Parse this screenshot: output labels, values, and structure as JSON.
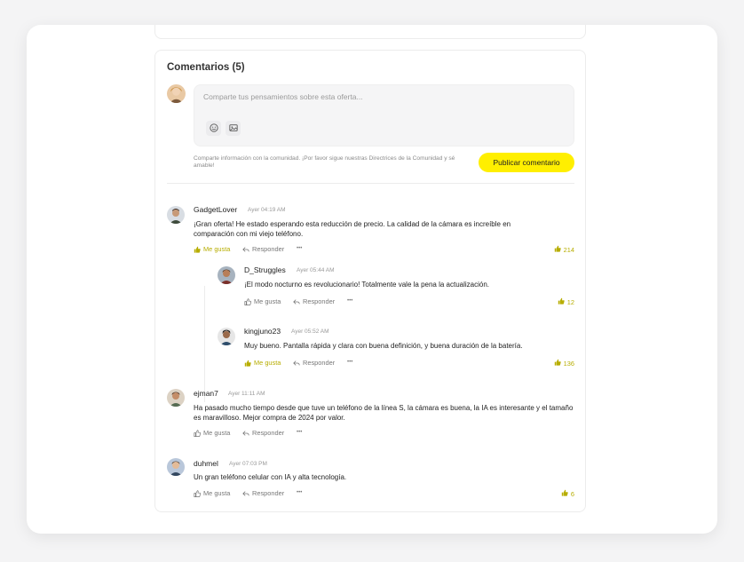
{
  "comments_title": "Comentarios (5)",
  "composer": {
    "placeholder": "Comparte tus pensamientos sobre esta oferta...",
    "hint": "Comparte información con la comunidad. ¡Por favor sigue nuestras Directrices de la Comunidad y sé amable!",
    "publish_label": "Publicar comentario"
  },
  "labels": {
    "like": "Me gusta",
    "reply": "Responder",
    "more": "•••"
  },
  "comments": [
    {
      "author": "GadgetLover",
      "time": "Ayer 04:19 AM",
      "text": "¡Gran oferta! He estado esperando esta reducción de precio. La calidad de la cámara es increíble en comparación con mi viejo teléfono.",
      "likes": "214",
      "liked": true
    },
    {
      "author": "D_Struggles",
      "time": "Ayer 05:44 AM",
      "text": "¡El modo nocturno es revolucionario! Totalmente vale la pena la actualización.",
      "likes": "12",
      "liked": false
    },
    {
      "author": "kingjuno23",
      "time": "Ayer 05:52 AM",
      "text": "Muy bueno. Pantalla rápida y clara con buena definición, y buena duración de la batería.",
      "likes": "136",
      "liked": true
    },
    {
      "author": "ejman7",
      "time": "Ayer 11:11 AM",
      "text": "Ha pasado mucho tiempo desde que tuve un teléfono de la línea S, la cámara es buena, la IA es interesante y el tamaño es maravilloso. Mejor compra de 2024 por valor.",
      "likes": "",
      "liked": false
    },
    {
      "author": "duhmel",
      "time": "Ayer 07:03 PM",
      "text": "Un gran teléfono celular con IA y alta tecnología.",
      "likes": "6",
      "liked": false
    }
  ],
  "colors": {
    "accent_yellow": "#ffef00",
    "liked_text": "#b7ad00",
    "card_border": "#ececec"
  }
}
